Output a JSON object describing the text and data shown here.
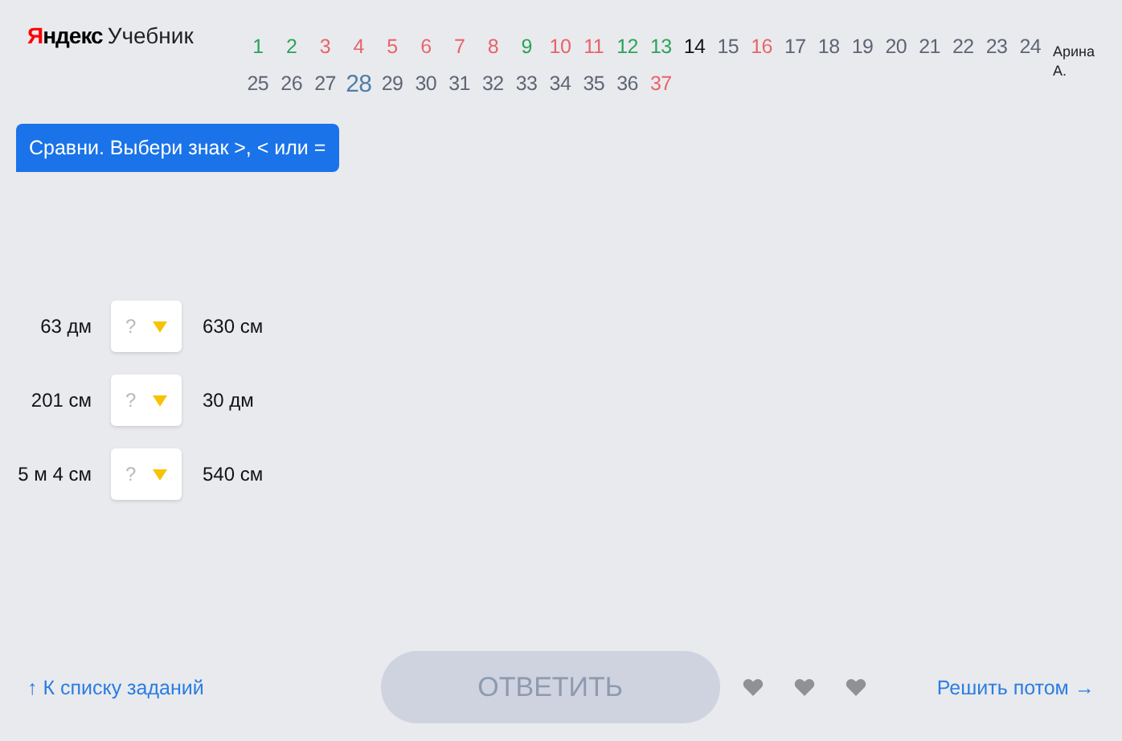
{
  "logo": {
    "brand": "Яндекс",
    "product": "Учебник"
  },
  "tasks": [
    {
      "label": "1",
      "color": "#2aa45a",
      "highlighted": false
    },
    {
      "label": "2",
      "color": "#2aa45a",
      "highlighted": false
    },
    {
      "label": "3",
      "color": "#e8646a",
      "highlighted": false
    },
    {
      "label": "4",
      "color": "#e8646a",
      "highlighted": false
    },
    {
      "label": "5",
      "color": "#e8646a",
      "highlighted": false
    },
    {
      "label": "6",
      "color": "#e8646a",
      "highlighted": false
    },
    {
      "label": "7",
      "color": "#e8646a",
      "highlighted": false
    },
    {
      "label": "8",
      "color": "#e8646a",
      "highlighted": false
    },
    {
      "label": "9",
      "color": "#2aa45a",
      "highlighted": false
    },
    {
      "label": "10",
      "color": "#e8646a",
      "highlighted": false
    },
    {
      "label": "11",
      "color": "#e8646a",
      "highlighted": false
    },
    {
      "label": "12",
      "color": "#2aa45a",
      "highlighted": false
    },
    {
      "label": "13",
      "color": "#2aa45a",
      "highlighted": false
    },
    {
      "label": "14",
      "color": "#111111",
      "highlighted": false
    },
    {
      "label": "15",
      "color": "#5e6573",
      "highlighted": false
    },
    {
      "label": "16",
      "color": "#e8646a",
      "highlighted": false
    },
    {
      "label": "17",
      "color": "#5e6573",
      "highlighted": false
    },
    {
      "label": "18",
      "color": "#5e6573",
      "highlighted": false
    },
    {
      "label": "19",
      "color": "#5e6573",
      "highlighted": false
    },
    {
      "label": "20",
      "color": "#5e6573",
      "highlighted": false
    },
    {
      "label": "21",
      "color": "#5e6573",
      "highlighted": false
    },
    {
      "label": "22",
      "color": "#5e6573",
      "highlighted": false
    },
    {
      "label": "23",
      "color": "#5e6573",
      "highlighted": false
    },
    {
      "label": "24",
      "color": "#5e6573",
      "highlighted": false
    },
    {
      "label": "25",
      "color": "#5e6573",
      "highlighted": false
    },
    {
      "label": "26",
      "color": "#5e6573",
      "highlighted": false
    },
    {
      "label": "27",
      "color": "#5e6573",
      "highlighted": false
    },
    {
      "label": "28",
      "color": "#4f7fa8",
      "highlighted": true
    },
    {
      "label": "29",
      "color": "#5e6573",
      "highlighted": false
    },
    {
      "label": "30",
      "color": "#5e6573",
      "highlighted": false
    },
    {
      "label": "31",
      "color": "#5e6573",
      "highlighted": false
    },
    {
      "label": "32",
      "color": "#5e6573",
      "highlighted": false
    },
    {
      "label": "33",
      "color": "#5e6573",
      "highlighted": false
    },
    {
      "label": "34",
      "color": "#5e6573",
      "highlighted": false
    },
    {
      "label": "35",
      "color": "#5e6573",
      "highlighted": false
    },
    {
      "label": "36",
      "color": "#5e6573",
      "highlighted": false
    },
    {
      "label": "37",
      "color": "#e8646a",
      "highlighted": false
    }
  ],
  "user": {
    "first": "Арина",
    "last": "А."
  },
  "instruction": "Сравни. Выбери знак >, < или =",
  "comparisons": [
    {
      "left": "63 дм",
      "placeholder": "?",
      "right": "630 см"
    },
    {
      "left": "201 см",
      "placeholder": "?",
      "right": "30 дм"
    },
    {
      "left": "5 м 4 см",
      "placeholder": "?",
      "right": "540 см"
    }
  ],
  "footer": {
    "back_link": "↑ К списку заданий",
    "answer_button": "ОТВЕТИТЬ",
    "answer_disabled": true,
    "later_link": "Решить потом →"
  }
}
